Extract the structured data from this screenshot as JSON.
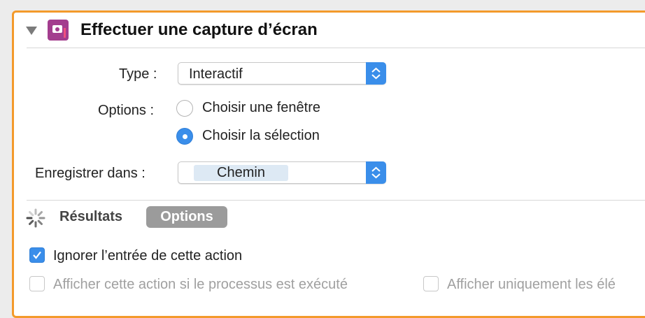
{
  "action": {
    "title": "Effectuer une capture d’écran",
    "icon": "screenshot-icon",
    "accent_color": "#a33d8e"
  },
  "form": {
    "type_label": "Type :",
    "type_value": "Interactif",
    "options_label": "Options :",
    "options": [
      {
        "label": "Choisir une fenêtre",
        "selected": false
      },
      {
        "label": "Choisir la sélection",
        "selected": true
      }
    ],
    "save_label": "Enregistrer dans :",
    "save_value": "Chemin"
  },
  "footer": {
    "tabs": [
      "Résultats",
      "Options"
    ],
    "active_tab": "Options",
    "checkboxes": [
      {
        "label": "Ignorer l’entrée de cette action",
        "checked": true,
        "enabled": true
      },
      {
        "label": "Afficher cette action si le processus est exécuté",
        "checked": false,
        "enabled": false
      },
      {
        "label": "Afficher uniquement les élé",
        "checked": false,
        "enabled": false
      }
    ]
  },
  "colors": {
    "focus_border": "#f39a2b",
    "control_blue": "#3a8eea"
  }
}
